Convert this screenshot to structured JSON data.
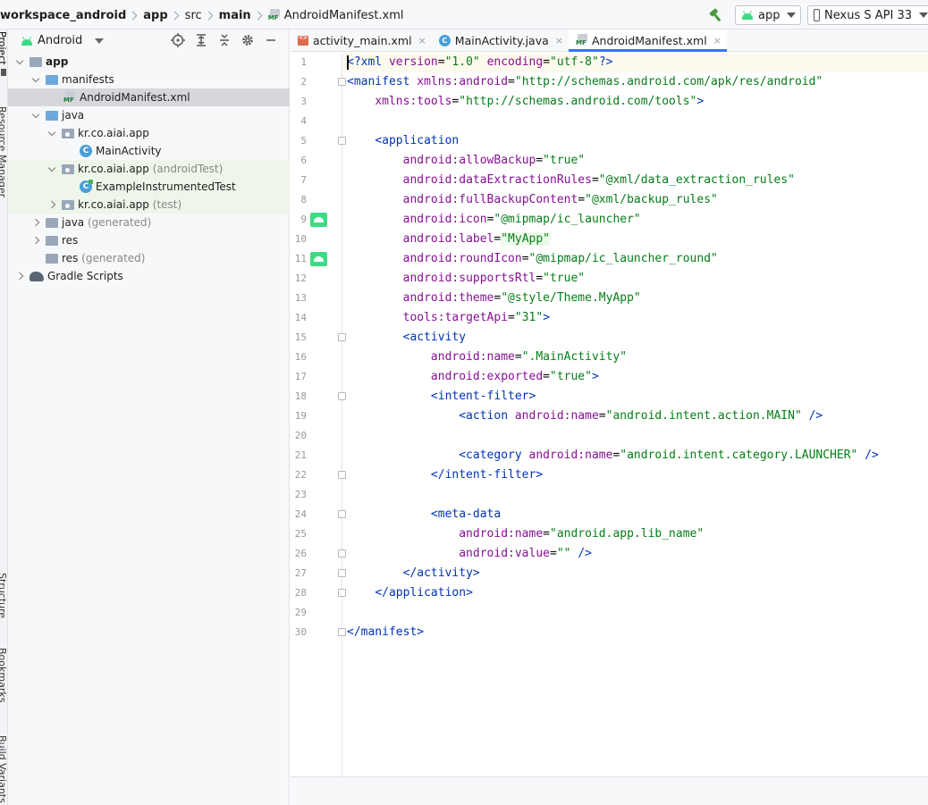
{
  "breadcrumb": {
    "items": [
      "workspace_android",
      "app",
      "src",
      "main",
      "AndroidManifest.xml"
    ]
  },
  "toolbar": {
    "run_config": "app",
    "device": "Nexus S API 33"
  },
  "left_strip": {
    "labels": [
      "Project",
      "Resource Manager",
      "Structure",
      "Bookmarks",
      "Build Variants"
    ]
  },
  "project_panel": {
    "view_mode": "Android",
    "tree": [
      {
        "label": "app",
        "suffix": ""
      },
      {
        "label": "manifests",
        "suffix": ""
      },
      {
        "label": "AndroidManifest.xml",
        "suffix": ""
      },
      {
        "label": "java",
        "suffix": ""
      },
      {
        "label": "kr.co.aiai.app",
        "suffix": ""
      },
      {
        "label": "MainActivity",
        "suffix": ""
      },
      {
        "label": "kr.co.aiai.app",
        "suffix": "(androidTest)"
      },
      {
        "label": "ExampleInstrumentedTest",
        "suffix": ""
      },
      {
        "label": "kr.co.aiai.app",
        "suffix": "(test)"
      },
      {
        "label": "java",
        "suffix": "(generated)"
      },
      {
        "label": "res",
        "suffix": ""
      },
      {
        "label": "res",
        "suffix": "(generated)"
      },
      {
        "label": "Gradle Scripts",
        "suffix": ""
      }
    ]
  },
  "editor": {
    "tabs": [
      {
        "label": "activity_main.xml",
        "close": "×"
      },
      {
        "label": "MainActivity.java",
        "close": "×"
      },
      {
        "label": "AndroidManifest.xml",
        "close": "×"
      }
    ],
    "active_tab": "AndroidManifest.xml",
    "line_numbers": [
      "1",
      "2",
      "3",
      "4",
      "5",
      "6",
      "7",
      "8",
      "9",
      "10",
      "11",
      "12",
      "13",
      "14",
      "15",
      "16",
      "17",
      "18",
      "19",
      "20",
      "21",
      "22",
      "23",
      "24",
      "25",
      "26",
      "27",
      "28",
      "29",
      "30"
    ],
    "code_lines": [
      "<?xml version=\"1.0\" encoding=\"utf-8\"?>",
      "<manifest xmlns:android=\"http://schemas.android.com/apk/res/android\"",
      "    xmlns:tools=\"http://schemas.android.com/tools\">",
      "",
      "    <application",
      "        android:allowBackup=\"true\"",
      "        android:dataExtractionRules=\"@xml/data_extraction_rules\"",
      "        android:fullBackupContent=\"@xml/backup_rules\"",
      "        android:icon=\"@mipmap/ic_launcher\"",
      "        android:label=\"MyApp\"",
      "        android:roundIcon=\"@mipmap/ic_launcher_round\"",
      "        android:supportsRtl=\"true\"",
      "        android:theme=\"@style/Theme.MyApp\"",
      "        tools:targetApi=\"31\">",
      "        <activity",
      "            android:name=\".MainActivity\"",
      "            android:exported=\"true\">",
      "            <intent-filter>",
      "                <action android:name=\"android.intent.action.MAIN\" />",
      "",
      "                <category android:name=\"android.intent.category.LAUNCHER\" />",
      "            </intent-filter>",
      "",
      "            <meta-data",
      "                android:name=\"android.app.lib_name\"",
      "                android:value=\"\" />",
      "        </activity>",
      "    </application>",
      "",
      "</manifest>"
    ]
  },
  "colors": {
    "tag": "#0033b3",
    "attribute": "#871094",
    "value": "#067d17",
    "selection_tab": "#3574f0",
    "android_green": "#3ddc84"
  }
}
